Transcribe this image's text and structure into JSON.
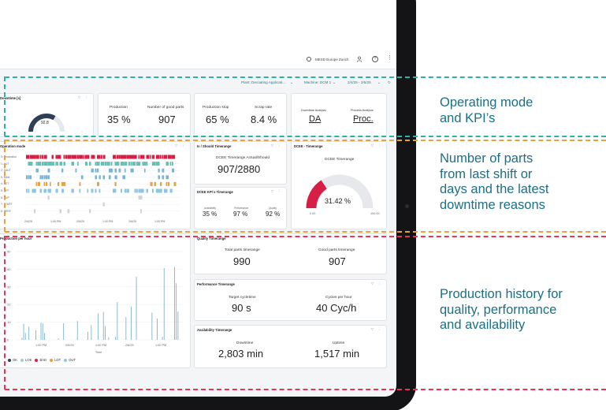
{
  "topbar": {
    "plant": "MESD Europe Zurich"
  },
  "filters": {
    "plant": "Plant: Decoating Applicati...",
    "machine": "Machine: DCM 1",
    "date_range": "2/4/25 - 2/6/25"
  },
  "downtime_card": {
    "title": "Downtime [s]",
    "gauge_value": "92.8"
  },
  "kpi_row": {
    "production_label": "Production",
    "production_value": "35 %",
    "good_parts_label": "Number of good parts",
    "good_parts_value": "907",
    "production_stop_label": "Production stop",
    "production_stop_value": "65 %",
    "scrap_label": "Scrap rate",
    "scrap_value": "8.4 %",
    "downtime_analysis_label": "Downtime Analysis",
    "downtime_analysis_value": "DA",
    "process_analysis_label": "Process Analysis",
    "process_analysis_value": "Proc."
  },
  "operation_mode": {
    "title": "Operation mode",
    "rows": [
      "0: Production",
      "1: AUT",
      "2: SAUT",
      "3: MAN",
      "4: SET",
      "5: OFF",
      "6: SUP",
      "7: START",
      "8: PERF"
    ],
    "x_ticks": [
      "2/4/25",
      "1:00 PM",
      "2/5/25",
      "1:00 PM",
      "2/6/25",
      "1:00 PM"
    ]
  },
  "is_should": {
    "title": "Is / Should Timerange",
    "label": "DCEE Timerange Actual/Should",
    "value": "907/2880"
  },
  "dcee_kpi": {
    "title": "DCEE KPI´s Timerange",
    "availability_label": "Availability",
    "availability_value": "35 %",
    "performance_label": "Performance",
    "performance_value": "97 %",
    "quality_label": "Quality",
    "quality_value": "92 %"
  },
  "dcee_gauge": {
    "title": "DCEE - Timerange",
    "label": "DCEE Timerange",
    "value": "31.42 %",
    "min": "0.00",
    "max": "100.00",
    "fraction": 0.3142
  },
  "production_per_hour": {
    "title": "Production per hour",
    "y_ticks": [
      "50",
      "40",
      "30",
      "20",
      "10",
      "0"
    ],
    "x_ticks": [
      "1:00 PM",
      "2/5/25",
      "1:00 PM",
      "2/6/25",
      "1:00 PM"
    ],
    "x_label": "Time",
    "legend": [
      "OK",
      "LOK",
      "BAD",
      "LOT",
      "OUT"
    ]
  },
  "quality": {
    "title": "Quality Timerange",
    "total_label": "Total parts timerange",
    "total_value": "990",
    "good_label": "Good parts timerange",
    "good_value": "907"
  },
  "performance": {
    "title": "Performance Timerange",
    "target_label": "Target cycletime",
    "target_value": "90 s",
    "cycles_label": "Cycles per hour",
    "cycles_value": "40 Cyc/h"
  },
  "availability": {
    "title": "Availability Timerange",
    "downtime_label": "Downtime",
    "downtime_value": "2,803 min",
    "uptime_label": "Uptime",
    "uptime_value": "1,517 min"
  },
  "annotations": {
    "note1": [
      "Operating mode",
      "and KPI’s"
    ],
    "note2": [
      "Number of parts",
      "from last shift or",
      "days and the latest",
      "downtime reasons"
    ],
    "note3": [
      "Production history for",
      "quality, performance",
      "and availability"
    ]
  },
  "colors": {
    "teal_annotation": "#2ab3a8",
    "orange_annotation": "#e8a23c",
    "red_annotation": "#e5335a",
    "gauge_red": "#d71f45",
    "bar_blue": "#7fb2cf"
  }
}
